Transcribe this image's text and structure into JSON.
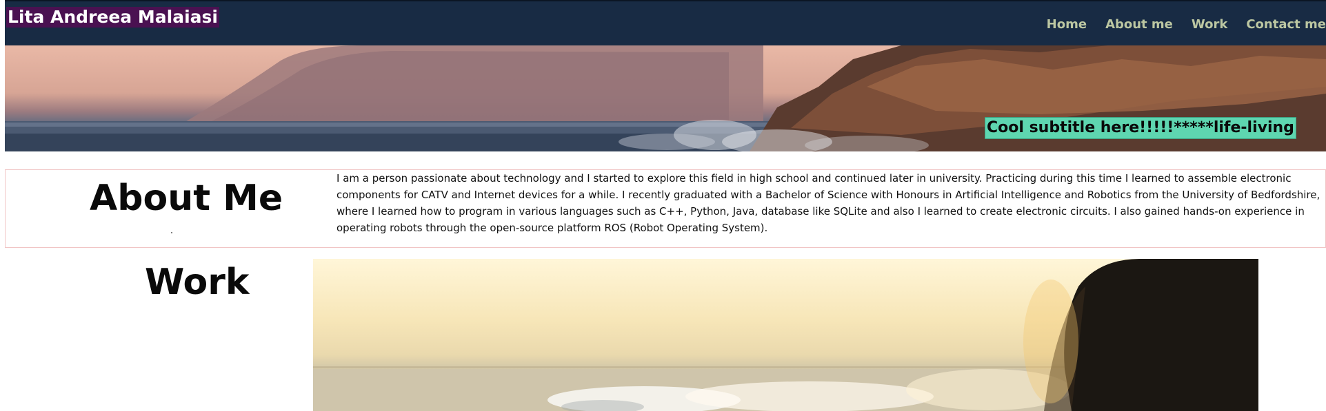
{
  "header": {
    "site_title": "Lita Andreea Malaiasi",
    "nav": [
      {
        "label": "Home"
      },
      {
        "label": "About me"
      },
      {
        "label": "Work"
      },
      {
        "label": "Contact me"
      }
    ]
  },
  "hero": {
    "subtitle": "Cool subtitle here!!!!!*****life-living"
  },
  "about": {
    "heading": "About Me",
    "text": "I am a person passionate about technology and I started to explore this field in high school and continued later in university. Practicing during this time I learned to assemble electronic components for CATV and Internet devices for a while. I recently graduated with a Bachelor of Science with Honours in Artificial Intelligence and Robotics from the University of Bedfordshire, where I learned how to program in various languages such as C++, Python, Java, database like SQLite and also I learned to create electronic circuits. I also gained hands-on experience in operating robots through the open-source platform ROS (Robot Operating System)."
  },
  "work": {
    "heading": "Work"
  },
  "colors": {
    "header_bg": "#182b44",
    "brand_bg": "#4a1151",
    "nav_text": "#bcc7a2",
    "subtitle_bg": "#5ed6b0",
    "about_border": "#f1c5c5"
  }
}
